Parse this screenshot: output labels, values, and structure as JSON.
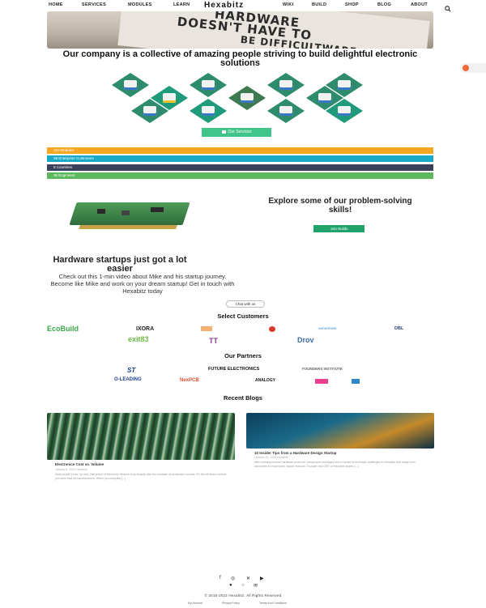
{
  "nav": {
    "left": [
      "HOME",
      "SERVICES",
      "MODULES",
      "LEARN"
    ],
    "brand": "Hexabitz",
    "right": [
      "WIKI",
      "BUILD",
      "SHOP",
      "BLOG",
      "ABOUT"
    ],
    "search_icon": "search-icon"
  },
  "hero": {
    "line1": "HARDWARE",
    "line2": "DOESN'T HAVE TO",
    "line3": "BE DIFFICULTWARE"
  },
  "tagline": "Our company is a collective of amazing people striving to build delightful electronic solutions",
  "services_button": "Our Services",
  "stats": [
    {
      "text": "110 Modules",
      "color": "#f6a623"
    },
    {
      "text": "38 Enterprise Customers",
      "color": "#19a9c9"
    },
    {
      "text": "8 Countries",
      "color": "#3a3f5c"
    },
    {
      "text": "36 Engineers",
      "color": "#5cb85c"
    }
  ],
  "explore": {
    "heading": "Explore some of our problem-solving skills!",
    "button": "Join Builds"
  },
  "startup": {
    "heading": "Hardware startups just got a lot easier",
    "body": "Check out this 1-min video about Mike and his startup journey. Become like Mike and work on your dream startup! Get in touch with Hexabitz today",
    "chat_button": "Chat with us"
  },
  "customers": {
    "title": "Select Customers",
    "logos": [
      "EcoBuild",
      "IXORA",
      "TT",
      "Drov",
      "exit83",
      "sensonote",
      "DBL"
    ]
  },
  "partners": {
    "title": "Our Partners",
    "logos": [
      "ST",
      "FUTURE ELECTRONICS",
      "FOUNDERS INSTITUTE",
      "O-LEADING",
      "NexPCB",
      "ANALOGY"
    ]
  },
  "blogs": {
    "title": "Recent Blogs",
    "posts": [
      {
        "title": "Electronics Cost vs. Volume",
        "date": "January 6, 2022  Hexabitz",
        "excerpt": "Most people know, by now, that prices of electronic devices drop sharply with the increase of production volume. It's the #6 factor behind you seen that all manufacturers. When you compare [...]"
      },
      {
        "title": "10 Insider Tips from a Hardware Design Startup",
        "date": "October 26, 2020  Hexabitz",
        "excerpt": "After building several hardware products, component shortages and a myriad of technical challenges in Hexabitz that range from warranties to enclosures. Bayan Hassan, Founder and CEO of Hexabitz shares [...]"
      }
    ]
  },
  "footer": {
    "copyright": "© 2016-2022 Hexabitz. All Rights Reserved",
    "links": [
      "My Account",
      "Privacy Policy",
      "Terms And Conditions"
    ]
  }
}
